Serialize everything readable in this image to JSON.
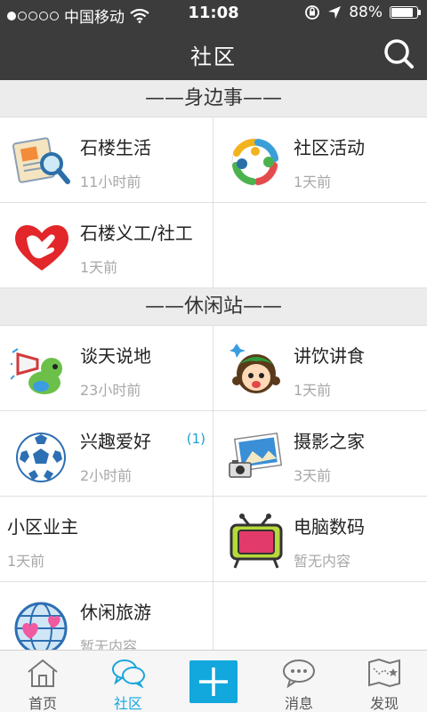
{
  "status_bar": {
    "carrier": "中国移动",
    "time": "11:08",
    "battery": "88%",
    "battery_level": 0.88,
    "signal_dots": 1
  },
  "nav": {
    "title": "社区",
    "search_icon": "search-icon"
  },
  "sections": [
    {
      "header": "——身边事——",
      "items": [
        {
          "title": "石楼生活",
          "sub": "11小时前",
          "icon": "scroll-magnifier-icon"
        },
        {
          "title": "社区活动",
          "sub": "1天前",
          "icon": "people-circle-icon"
        },
        {
          "title": "石楼义工/社工",
          "sub": "1天前",
          "icon": "heart-hand-icon"
        }
      ]
    },
    {
      "header": "——休闲站——",
      "items": [
        {
          "title": "谈天说地",
          "sub": "23小时前",
          "icon": "megaphone-bird-icon"
        },
        {
          "title": "讲饮讲食",
          "sub": "1天前",
          "icon": "girl-face-icon"
        },
        {
          "title": "兴趣爱好",
          "sub": "2小时前",
          "badge": "(1)",
          "icon": "soccer-ball-icon"
        },
        {
          "title": "摄影之家",
          "sub": "3天前",
          "icon": "camera-photo-icon"
        },
        {
          "title": "小区业主",
          "sub": "1天前",
          "icon": ""
        },
        {
          "title": "电脑数码",
          "sub": "暂无内容",
          "icon": "tv-icon"
        },
        {
          "title": "休闲旅游",
          "sub": "暂无内容",
          "icon": "globe-hearts-icon"
        }
      ]
    }
  ],
  "tabbar": {
    "tabs": [
      {
        "label": "首页",
        "icon": "home-icon",
        "active": false
      },
      {
        "label": "社区",
        "icon": "chat-bubbles-icon",
        "active": true
      },
      {
        "label": "",
        "icon": "plus-icon",
        "active": false
      },
      {
        "label": "消息",
        "icon": "message-icon",
        "active": false
      },
      {
        "label": "发现",
        "icon": "map-icon",
        "active": false
      }
    ]
  },
  "colors": {
    "bar": "#3c3c3c",
    "accent": "#1aa6dd",
    "section_bg": "#ececec",
    "subtext": "#a8a8a8"
  }
}
